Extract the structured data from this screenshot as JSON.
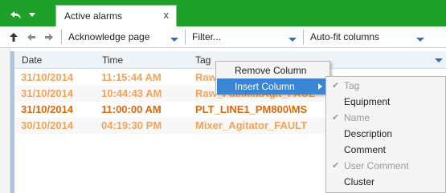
{
  "tabs": {
    "home_icon": "undo-arrow-icon",
    "home_caret": "chevron-down-icon",
    "active_tab_label": "Active alarms",
    "close_glyph": "x"
  },
  "toolbar": {
    "acknowledge_label": "Acknowledge page",
    "filter_label": "Filter...",
    "autofit_label": "Auto-fit columns"
  },
  "grid": {
    "columns": [
      "Date",
      "Time",
      "Tag"
    ],
    "rows": [
      {
        "date": "31/10/2014",
        "time": "11:15:44 AM",
        "tag": "Raw_",
        "style": "light"
      },
      {
        "date": "31/10/2014",
        "time": "10:44:43 AM",
        "tag": "Raw_FullMilkAgit_FAUL",
        "style": "light"
      },
      {
        "date": "31/10/2014",
        "time": "11:00:00 AM",
        "tag": "PLT_LINE1_PM800\\MS",
        "style": "dark"
      },
      {
        "date": "30/10/2014",
        "time": "04:19:30 PM",
        "tag": "Mixer_Agitator_FAULT",
        "style": "light"
      }
    ]
  },
  "context_menu": {
    "remove_column": "Remove Column",
    "insert_column": "Insert Column"
  },
  "submenu": {
    "items": [
      {
        "label": "Tag",
        "checked": true,
        "disabled": true
      },
      {
        "label": "Equipment",
        "checked": false,
        "disabled": false
      },
      {
        "label": "Name",
        "checked": true,
        "disabled": true
      },
      {
        "label": "Description",
        "checked": false,
        "disabled": false
      },
      {
        "label": "Comment",
        "checked": false,
        "disabled": false
      },
      {
        "label": "User Comment",
        "checked": true,
        "disabled": true
      },
      {
        "label": "Cluster",
        "checked": false,
        "disabled": false
      }
    ]
  },
  "colors": {
    "tab_green": "#1ea02b",
    "alarm_light": "#f0a35a",
    "alarm_dark": "#d76a0c",
    "menu_highlight": "#3a86d4"
  }
}
